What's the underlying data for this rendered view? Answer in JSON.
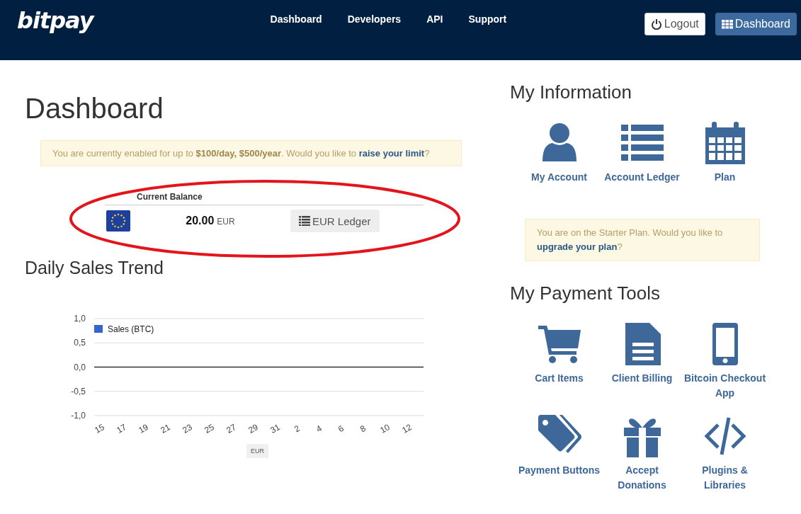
{
  "header": {
    "logo": "bitpay",
    "nav": [
      "Dashboard",
      "Developers",
      "API",
      "Support"
    ],
    "buttons": [
      {
        "kind": "logout",
        "label": "Logout"
      },
      {
        "kind": "dashboard",
        "label": "Dashboard"
      }
    ]
  },
  "page_title": "Dashboard",
  "limit_alert": {
    "text": "You are currently enabled for up to **$100/day, $500/year**. Would you like to ",
    "link": "raise your limit",
    "after": "?"
  },
  "balance": {
    "heading": "Current Balance",
    "amount": "20.00",
    "currency": "EUR",
    "ledger_button": "EUR Ledger"
  },
  "sales_trend": {
    "title": "Daily Sales Trend",
    "currency_button": "EUR",
    "chart_data": {
      "type": "line",
      "categories": [
        "15",
        "17",
        "19",
        "21",
        "23",
        "25",
        "27",
        "29",
        "31",
        "2",
        "4",
        "6",
        "8",
        "10",
        "12"
      ],
      "series": [
        {
          "name": "Sales (BTC)",
          "color": "#3366cc",
          "values": [
            null,
            null,
            null,
            null,
            null,
            null,
            null,
            null,
            null,
            null,
            null,
            null,
            null,
            null,
            null
          ]
        }
      ],
      "ylim": [
        -1,
        1
      ],
      "yticks": [
        {
          "value": 1,
          "label": "1,0"
        },
        {
          "value": 0.5,
          "label": "0,5"
        },
        {
          "value": 0,
          "label": "0,0"
        },
        {
          "value": -0.5,
          "label": "-0,5"
        },
        {
          "value": -1,
          "label": "-1,0"
        }
      ]
    }
  },
  "my_information": {
    "title": "My Information",
    "items": [
      "My Account",
      "Account Ledger",
      "Plan"
    ]
  },
  "plan_alert": {
    "text": "You are on the Starter Plan. Would you like to ",
    "link": "upgrade your plan",
    "after": "?"
  },
  "payment_tools": {
    "title": "My Payment Tools",
    "items": [
      "Cart Items",
      "Client Billing",
      "Bitcoin Checkout App",
      "Payment Buttons",
      "Accept Donations",
      "Plugins & Libraries"
    ]
  }
}
